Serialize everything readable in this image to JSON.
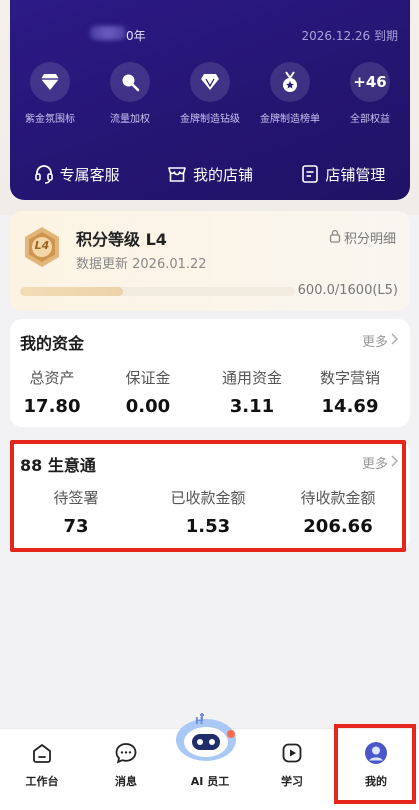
{
  "member": {
    "years": "0年",
    "expire": "2026.12.26 到期",
    "benefits": [
      {
        "label": "紫金氛围标",
        "icon": "diamond-icon"
      },
      {
        "label": "流量加权",
        "icon": "search-icon"
      },
      {
        "label": "金牌制造钻级",
        "icon": "diamond-badge-icon"
      },
      {
        "label": "金牌制造榜单",
        "icon": "medal-icon"
      },
      {
        "label": "全部权益",
        "count": "+46"
      }
    ],
    "actions": [
      {
        "label": "专属客服",
        "icon": "headset-icon"
      },
      {
        "label": "我的店铺",
        "icon": "store-icon"
      },
      {
        "label": "店铺管理",
        "icon": "document-icon"
      }
    ]
  },
  "level": {
    "badge": "L4",
    "title": "积分等级 L4",
    "update": "数据更新 2026.01.22",
    "detail_label": "积分明细",
    "progress_text": "600.0/1600(L5)",
    "progress_fraction": 0.375
  },
  "funds": {
    "title": "我的资金",
    "more": "更多",
    "items": [
      {
        "label": "总资产",
        "value": "17.80"
      },
      {
        "label": "保证金",
        "value": "0.00"
      },
      {
        "label": "通用资金",
        "value": "3.11"
      },
      {
        "label": "数字营销",
        "value": "14.69"
      }
    ]
  },
  "biz": {
    "title": "88 生意通",
    "more": "更多",
    "items": [
      {
        "label": "待签署",
        "value": "73"
      },
      {
        "label": "已收款金额",
        "value": "1.53"
      },
      {
        "label": "待收款金额",
        "value": "206.66"
      }
    ]
  },
  "tabs": [
    {
      "label": "工作台",
      "icon": "workbench-icon"
    },
    {
      "label": "消息",
      "icon": "message-icon"
    },
    {
      "label": "AI 员工",
      "icon": "robot-icon"
    },
    {
      "label": "学习",
      "icon": "play-icon"
    },
    {
      "label": "我的",
      "icon": "profile-icon"
    }
  ],
  "colors": {
    "card_purple": "#261676",
    "highlight_red": "#e4261d",
    "level_gold": "#d8a25e"
  }
}
